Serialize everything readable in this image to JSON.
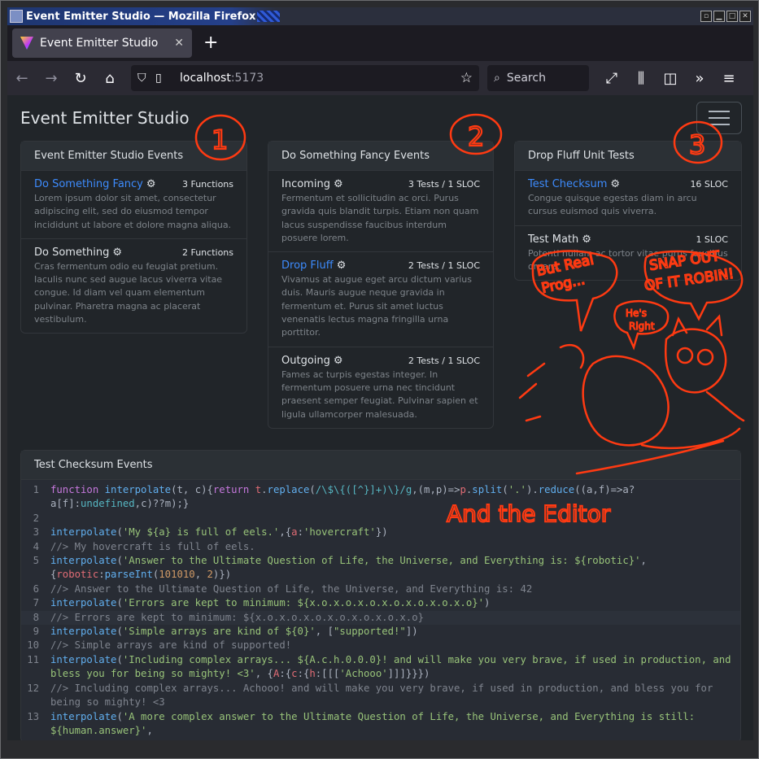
{
  "window": {
    "title": "Event Emitter Studio — Mozilla Firefox"
  },
  "browser": {
    "tab_title": "Event Emitter Studio",
    "url_host": "localhost",
    "url_port": ":5173",
    "search_placeholder": "Search"
  },
  "app": {
    "title": "Event Emitter Studio"
  },
  "cards": [
    {
      "header": "Event Emitter Studio Events",
      "items": [
        {
          "name": "Do Something Fancy",
          "link": true,
          "badge": "3 Functions",
          "desc": "Lorem ipsum dolor sit amet, consectetur adipiscing elit, sed do eiusmod tempor incididunt ut labore et dolore magna aliqua."
        },
        {
          "name": "Do Something",
          "link": false,
          "badge": "2 Functions",
          "desc": "Cras fermentum odio eu feugiat pretium. Iaculis nunc sed augue lacus viverra vitae congue. Id diam vel quam elementum pulvinar. Pharetra magna ac placerat vestibulum."
        }
      ]
    },
    {
      "header": "Do Something Fancy Events",
      "items": [
        {
          "name": "Incoming",
          "link": false,
          "badge": "3 Tests / 1 SLOC",
          "desc": "Fermentum et sollicitudin ac orci. Purus gravida quis blandit turpis. Etiam non quam lacus suspendisse faucibus interdum posuere lorem."
        },
        {
          "name": "Drop Fluff",
          "link": true,
          "badge": "2 Tests / 1 SLOC",
          "desc": "Vivamus at augue eget arcu dictum varius duis. Mauris augue neque gravida in fermentum et. Purus sit amet luctus venenatis lectus magna fringilla urna porttitor."
        },
        {
          "name": "Outgoing",
          "link": false,
          "badge": "2 Tests / 1 SLOC",
          "desc": "Fames ac turpis egestas integer. In fermentum posuere urna nec tincidunt praesent semper feugiat. Pulvinar sapien et ligula ullamcorper malesuada."
        }
      ]
    },
    {
      "header": "Drop Fluff Unit Tests",
      "items": [
        {
          "name": "Test Checksum",
          "link": true,
          "badge": "16 SLOC",
          "desc": "Congue quisque egestas diam in arcu cursus euismod quis viverra."
        },
        {
          "name": "Test Math",
          "link": false,
          "badge": "1 SLOC",
          "desc": "Potenti nullam ac tortor vitae purus faucibus ornare."
        }
      ]
    }
  ],
  "editor": {
    "header": "Test Checksum Events",
    "line_numbers": [
      "1",
      "2",
      "3",
      "4",
      "5",
      "6",
      "7",
      "8",
      "9",
      "10",
      "11",
      "12",
      "13"
    ]
  },
  "annotations": {
    "num1": "1",
    "num2": "2",
    "num3": "3",
    "but_real": "But Real",
    "prog": "Prog...",
    "snap": "SNAP OUT",
    "of_it": "OF IT ROBIN!",
    "hes": "He's",
    "right": "Right",
    "editor_caption": "And the Editor"
  },
  "icons": {
    "gear": "gear-icon",
    "close": "close-icon",
    "plus": "plus-icon",
    "back": "back-arrow-icon",
    "forward": "forward-arrow-icon",
    "reload": "reload-icon",
    "home": "home-icon",
    "shield": "shield-icon",
    "page": "page-icon",
    "star": "star-icon",
    "search": "search-icon",
    "fullscreen": "fullscreen-icon",
    "library": "library-icon",
    "sidebar": "sidebar-icon",
    "overflow": "overflow-icon",
    "menu": "menu-icon"
  },
  "colors": {
    "accent": "#3d8bfd",
    "annotation": "#ff3a12",
    "background": "#212529"
  }
}
